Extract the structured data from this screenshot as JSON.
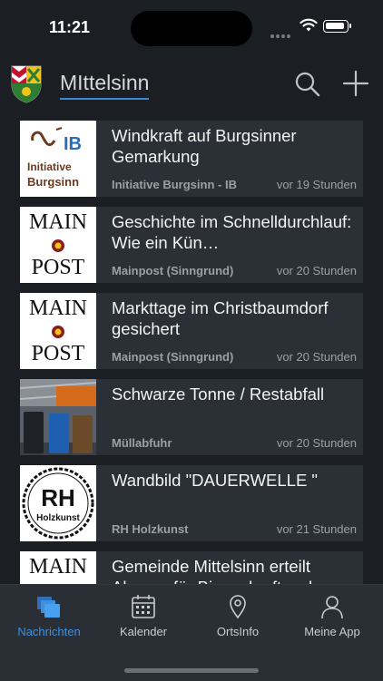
{
  "status": {
    "time": "11:21"
  },
  "header": {
    "place": "MIttelsinn"
  },
  "news": [
    {
      "title": "Windkraft auf Burgsinner Gemarkung",
      "source": "Initiative Burgsinn - IB",
      "age": "vor 19 Stunden",
      "thumb": "ib-logo"
    },
    {
      "title": "Geschichte im Schnelldurchlauf: Wie ein Kün…",
      "source": "Mainpost (Sinngrund)",
      "age": "vor 20 Stunden",
      "thumb": "mainpost-logo"
    },
    {
      "title": "Markttage im Christbaumdorf gesichert",
      "source": "Mainpost (Sinngrund)",
      "age": "vor 20 Stunden",
      "thumb": "mainpost-logo"
    },
    {
      "title": "Schwarze Tonne / Restabfall",
      "source": "Müllabfuhr",
      "age": "vor 20 Stunden",
      "thumb": "waste-bins-photo"
    },
    {
      "title": "Wandbild \"DAUERWELLE \"",
      "source": "RH Holzkunst",
      "age": "vor 21 Stunden",
      "thumb": "rh-logo"
    },
    {
      "title": "Gemeinde Mittelsinn erteilt Absage für Biogaskraftwerk",
      "source": "",
      "age": "",
      "thumb": "mainpost-logo"
    }
  ],
  "thumbs": {
    "ib_line1": "Initiative",
    "ib_line2": "Burgsinn",
    "mp_top": "MAIN",
    "mp_bottom": "POST",
    "rh_big": "RH",
    "rh_small": "Holzkunst"
  },
  "tabs": [
    {
      "label": "Nachrichten",
      "icon": "news-icon",
      "active": true
    },
    {
      "label": "Kalender",
      "icon": "calendar-icon",
      "active": false
    },
    {
      "label": "OrtsInfo",
      "icon": "location-pin-icon",
      "active": false
    },
    {
      "label": "Meine App",
      "icon": "person-icon",
      "active": false
    }
  ],
  "colors": {
    "accent": "#3d8fe0",
    "background": "#1b1f24",
    "card": "#2b3036"
  }
}
